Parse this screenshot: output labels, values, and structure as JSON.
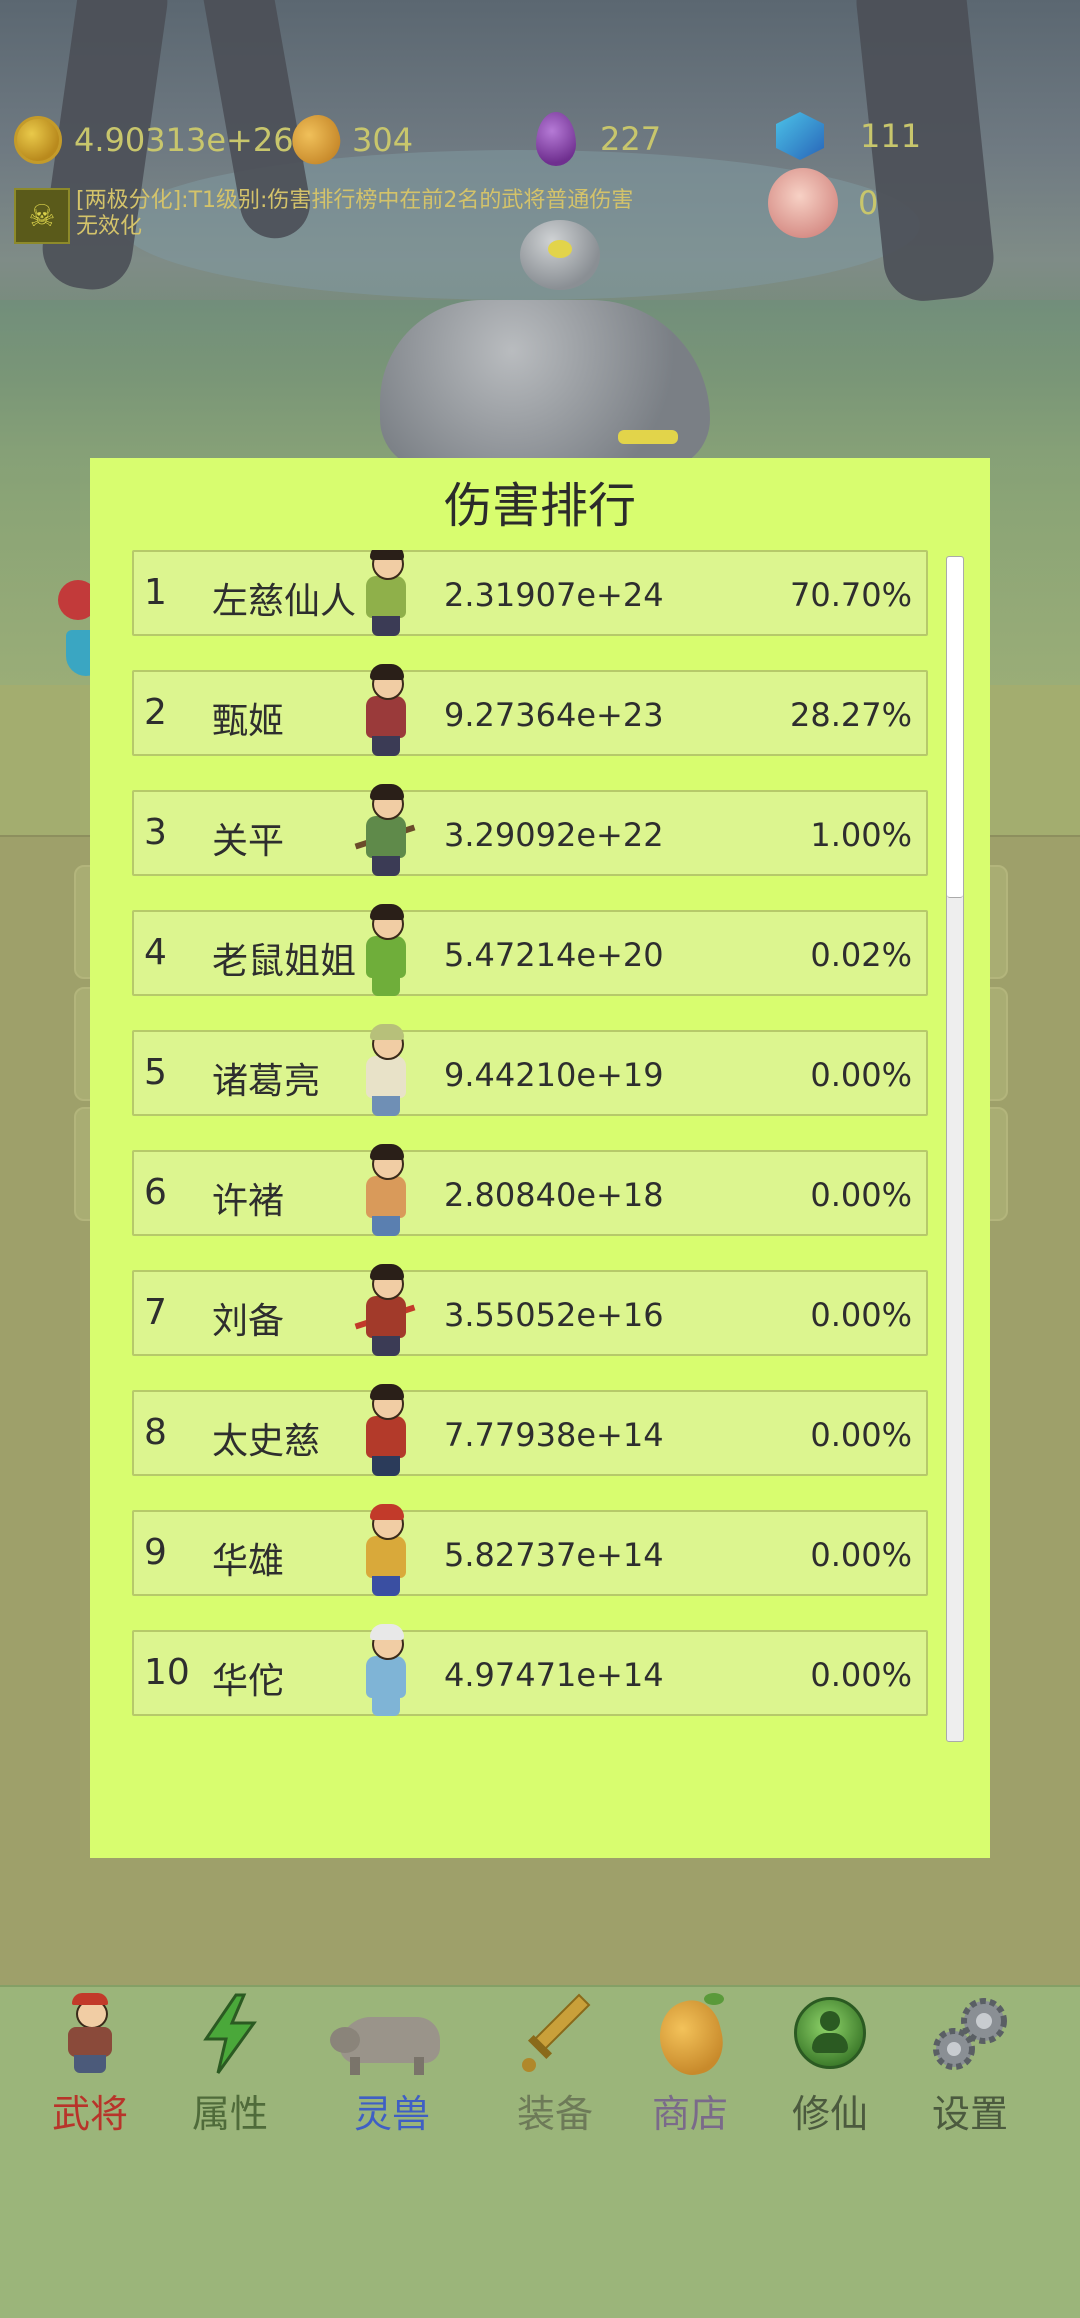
{
  "resources": {
    "gold": "4.90313e+26",
    "mango": "304",
    "potion": "227",
    "gem": "111",
    "peach": "0"
  },
  "notice": {
    "text": "[两极分化]:T1级别:伤害排行榜中在前2名的武将普通伤害无效化"
  },
  "dialog": {
    "title": "伤害排行",
    "rows": [
      {
        "rank": "1",
        "name": "左慈仙人",
        "damage": "2.31907e+24",
        "percent": "70.70%"
      },
      {
        "rank": "2",
        "name": "甄姬",
        "damage": "9.27364e+23",
        "percent": "28.27%"
      },
      {
        "rank": "3",
        "name": "关平",
        "damage": "3.29092e+22",
        "percent": "1.00%"
      },
      {
        "rank": "4",
        "name": "老鼠姐姐",
        "damage": "5.47214e+20",
        "percent": "0.02%"
      },
      {
        "rank": "5",
        "name": "诸葛亮",
        "damage": "9.44210e+19",
        "percent": "0.00%"
      },
      {
        "rank": "6",
        "name": "许褚",
        "damage": "2.80840e+18",
        "percent": "0.00%"
      },
      {
        "rank": "7",
        "name": "刘备",
        "damage": "3.55052e+16",
        "percent": "0.00%"
      },
      {
        "rank": "8",
        "name": "太史慈",
        "damage": "7.77938e+14",
        "percent": "0.00%"
      },
      {
        "rank": "9",
        "name": "华雄",
        "damage": "5.82737e+14",
        "percent": "0.00%"
      },
      {
        "rank": "10",
        "name": "华佗",
        "damage": "4.97471e+14",
        "percent": "0.00%"
      }
    ]
  },
  "nav": {
    "tabs": [
      {
        "label": "武将",
        "color": "#b8342a"
      },
      {
        "label": "属性",
        "color": "#4f6b3a"
      },
      {
        "label": "灵兽",
        "color": "#3f5fc4"
      },
      {
        "label": "装备",
        "color": "#6d7a58"
      },
      {
        "label": "商店",
        "color": "#7a6a8a"
      },
      {
        "label": "修仙",
        "color": "#4b5a3e"
      },
      {
        "label": "设置",
        "color": "#4b5a3e"
      }
    ]
  }
}
